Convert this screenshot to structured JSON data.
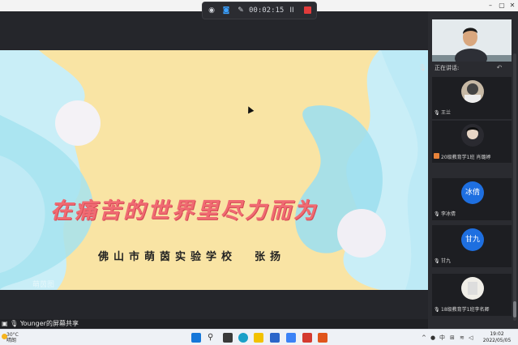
{
  "recorder": {
    "time": "00:02:15",
    "pause_label": "II"
  },
  "slide": {
    "title": "在痛苦的世界里尽力而为",
    "school": "佛山市萌茵实验学校",
    "author": "张扬",
    "watermark": "萌茵图"
  },
  "screen_share": {
    "label": "Younger的屏幕共享"
  },
  "panel": {
    "speaking_label": "正在讲话:",
    "participants": [
      {
        "name": "王兰",
        "avatar_text": "",
        "avatar_kind": "photo",
        "mic_badge": ""
      },
      {
        "name": "20级教育学1班 肖璐婷",
        "avatar_text": "",
        "avatar_kind": "photo",
        "mic_badge": "orange"
      },
      {
        "name": "李冰倩",
        "avatar_text": "冰倩",
        "avatar_kind": "blue",
        "mic_badge": ""
      },
      {
        "name": "甘九",
        "avatar_text": "甘九",
        "avatar_kind": "blue",
        "mic_badge": ""
      },
      {
        "name": "18级教育学1班李名卿",
        "avatar_text": "",
        "avatar_kind": "photo",
        "mic_badge": ""
      }
    ]
  },
  "taskbar": {
    "weather_temp": "30°C",
    "weather_desc": "晴朗",
    "time": "19:02",
    "date": "2022/05/05",
    "lang": "中"
  },
  "colors": {
    "slide_bg": "#c9eef7",
    "slide_yellow": "#f9e4a4",
    "title_pink": "#f06a72",
    "record_red": "#e23b3b",
    "avatar_blue": "#1e6fe0"
  }
}
